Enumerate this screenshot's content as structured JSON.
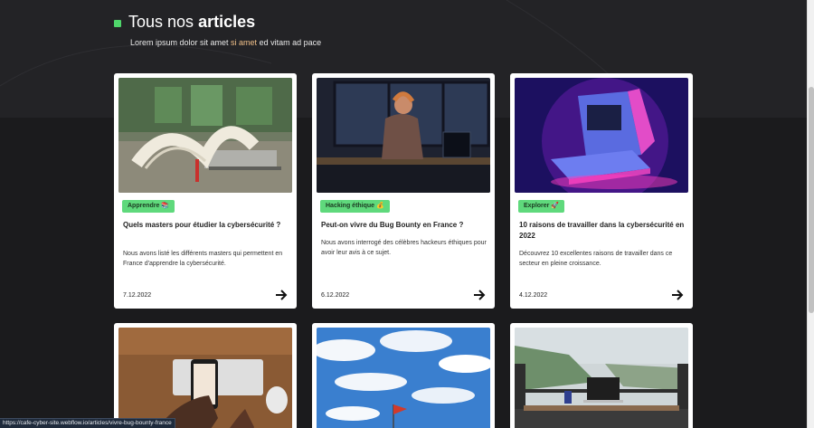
{
  "section": {
    "title_light": "Tous nos",
    "title_bold": "articles",
    "subtitle_before": "Lorem ipsum dolor sit amet ",
    "subtitle_highlight": "si amet",
    "subtitle_after": " ed vitam ad pace"
  },
  "articles": [
    {
      "tag": "Apprendre 📚",
      "title": "Quels masters pour étudier la cybersécurité ?",
      "excerpt": "Nous avons listé les différents masters qui permettent en France d'apprendre la cybersécurité.",
      "date": "7.12.2022",
      "image": "open-book-on-laptop"
    },
    {
      "tag": "Hacking éthique 💰",
      "title": "Peut-on vivre du Bug Bounty en France ?",
      "excerpt": "Nous avons interrogé des célèbres hackeurs éthiques pour avoir leur avis à ce sujet.",
      "date": "6.12.2022",
      "image": "woman-at-computer-night"
    },
    {
      "tag": "Explorer 🚀",
      "title": "10 raisons de travailler dans la cybersécurité en 2022",
      "excerpt": "Découvrez 10 excellentes raisons de travailler dans ce secteur en pleine croissance.",
      "date": "4.12.2022",
      "image": "retro-computer-neon"
    },
    {
      "image": "hands-with-phone-keyboard"
    },
    {
      "image": "sky-with-red-flag"
    },
    {
      "image": "desk-overlooking-city"
    }
  ],
  "status_url": "https://cafe-cyber-site.webflow.io/articles/vivre-bug-bounty-france",
  "colors": {
    "background": "#1b1b1d",
    "accent_green": "#5fd97c",
    "highlight": "#f1c08a"
  },
  "icons": {
    "card_link": "arrow-right-icon",
    "bullet": "square-bullet-icon"
  }
}
